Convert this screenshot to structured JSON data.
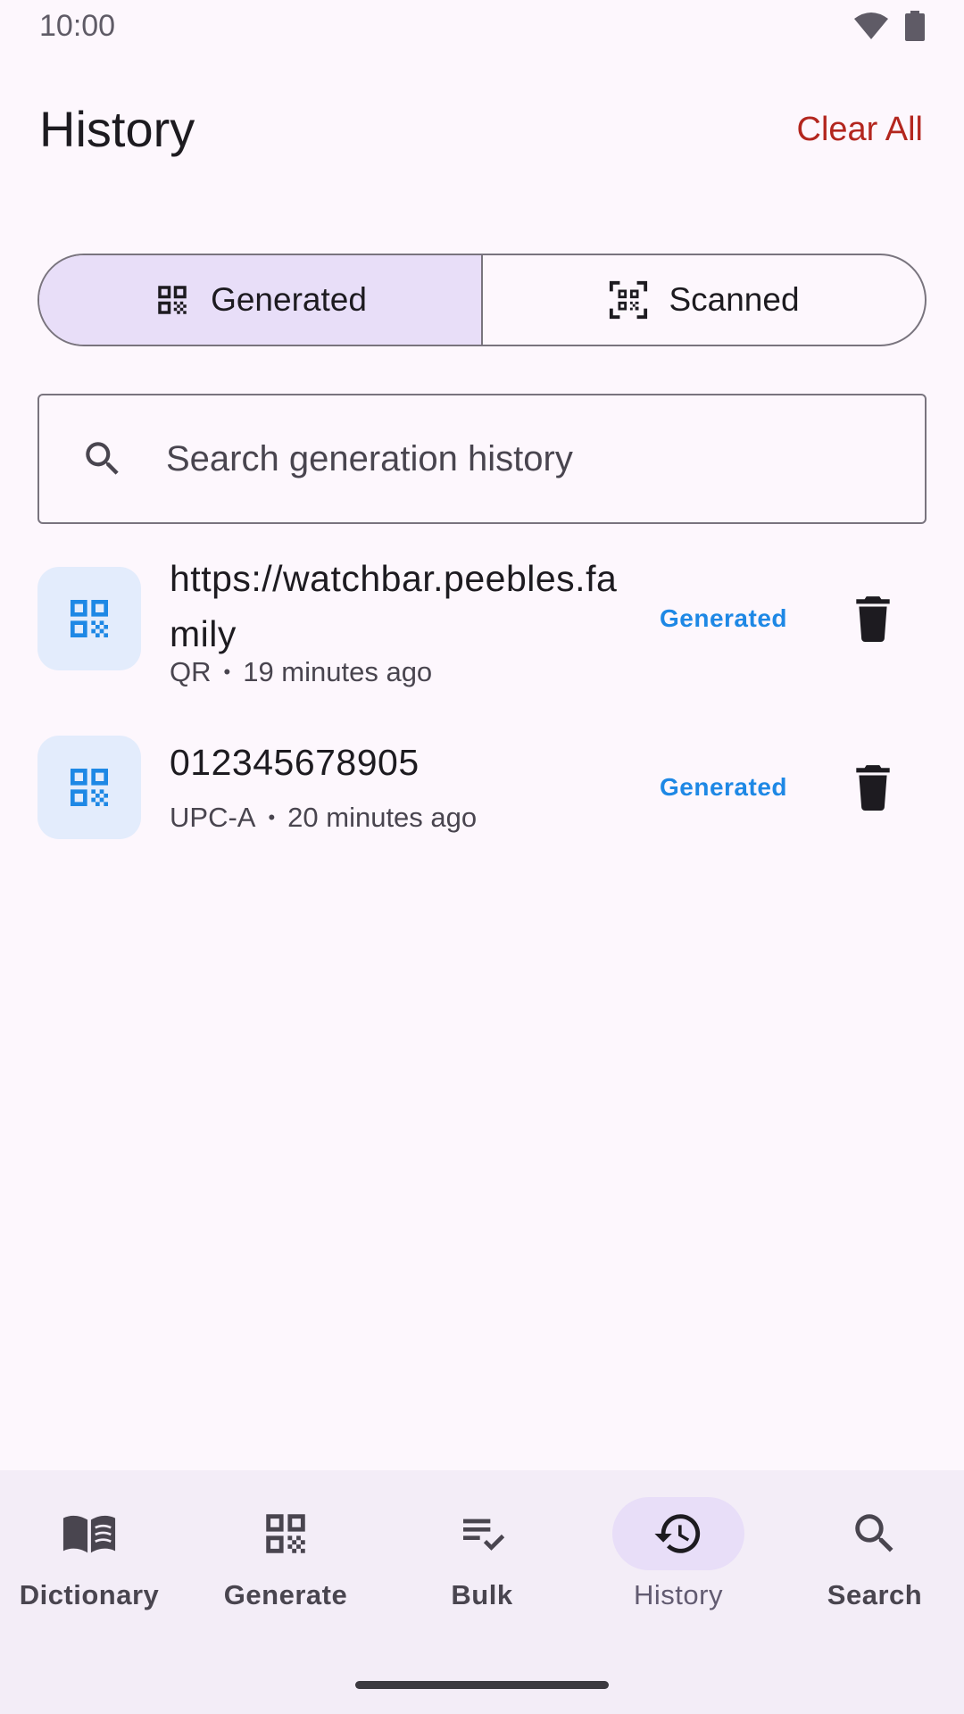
{
  "status_bar": {
    "time": "10:00",
    "icons": [
      "wifi-icon",
      "battery-icon"
    ]
  },
  "header": {
    "title": "History",
    "clear_all_label": "Clear All"
  },
  "segments": [
    {
      "label": "Generated",
      "icon": "qr-code-icon",
      "selected": true
    },
    {
      "label": "Scanned",
      "icon": "qr-scan-icon",
      "selected": false
    }
  ],
  "search": {
    "placeholder": "Search generation history",
    "value": ""
  },
  "items": [
    {
      "title": "https://watchbar.peebles.family",
      "type": "QR",
      "time": "19 minutes ago",
      "status": "Generated"
    },
    {
      "title": "012345678905",
      "type": "UPC-A",
      "time": "20 minutes ago",
      "status": "Generated"
    }
  ],
  "meta_separator": "•",
  "nav": {
    "items": [
      {
        "label": "Dictionary",
        "icon": "book-icon"
      },
      {
        "label": "Generate",
        "icon": "qr-code-icon"
      },
      {
        "label": "Bulk",
        "icon": "checklist-icon"
      },
      {
        "label": "History",
        "icon": "history-icon",
        "active": true
      },
      {
        "label": "Search",
        "icon": "search-icon"
      }
    ]
  },
  "colors": {
    "background": "#fdf7fd",
    "accent_red": "#b3261e",
    "status_blue": "#1e88e5",
    "selected_container": "#e8def8",
    "nav_background": "#f3edf7"
  }
}
